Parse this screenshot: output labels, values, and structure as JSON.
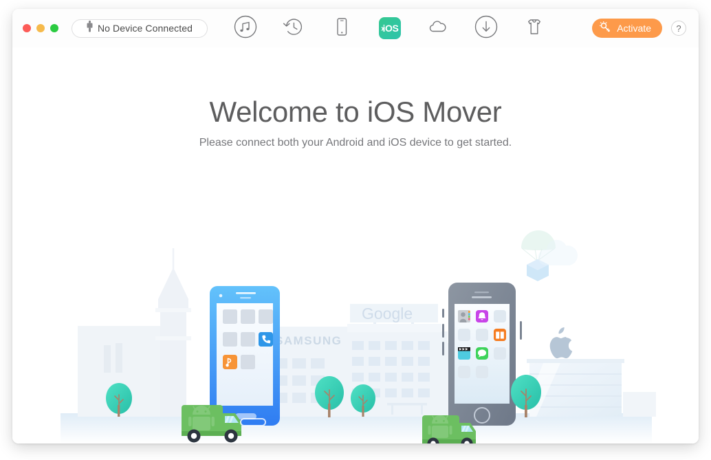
{
  "window": {
    "traffic_lights": [
      "close",
      "minimize",
      "maximize"
    ],
    "colors": {
      "close": "#fc5b57",
      "minimize": "#f6ba4b",
      "maximize": "#2bcb41",
      "accent_orange": "#fd9a4a",
      "ios_green": "#31c6a0",
      "android_blue": "#3f9cf4",
      "truck_green": "#6cbf61",
      "tree_teal": "#3fd0b8"
    }
  },
  "toolbar": {
    "device_status": "No Device Connected",
    "device_icon": "plug-icon",
    "items": [
      {
        "id": "music",
        "icon": "music-note-circle-icon",
        "label": "Music"
      },
      {
        "id": "backup",
        "icon": "history-clock-icon",
        "label": "Backup Restore"
      },
      {
        "id": "device",
        "icon": "phone-outline-icon",
        "label": "Device"
      },
      {
        "id": "iosmover",
        "icon": "ios-mover-badge-icon",
        "label": "iOS Mover",
        "badge_text": "iOS",
        "badge_chevron": "›",
        "active": true
      },
      {
        "id": "cloud",
        "icon": "cloud-icon",
        "label": "Cloud"
      },
      {
        "id": "download",
        "icon": "download-circle-icon",
        "label": "Downloader"
      },
      {
        "id": "ringtone",
        "icon": "ringtone-shirt-icon",
        "label": "Ringtone Maker"
      }
    ],
    "activate_label": "Activate",
    "activate_icon": "key-icon",
    "help_label": "?"
  },
  "main": {
    "headline": "Welcome to iOS Mover",
    "subhead": "Please connect both your Android and iOS device to get started."
  },
  "illustration": {
    "buildings": [
      {
        "id": "samsung",
        "sign": "SAMSUNG"
      },
      {
        "id": "google",
        "sign": "Google"
      },
      {
        "id": "apple",
        "sign": "",
        "logo": "apple-logo-icon"
      },
      {
        "id": "tower",
        "sign": ""
      }
    ],
    "android_phone": {
      "name": "android-phone",
      "apps": [
        "placeholder",
        "placeholder",
        "placeholder",
        "placeholder",
        "placeholder",
        "phone-app-icon",
        "music-app-icon",
        "placeholder",
        ""
      ]
    },
    "ios_phone": {
      "name": "ios-phone",
      "apps": [
        "contacts-app-icon",
        "ringtone-app-icon",
        "placeholder",
        "placeholder",
        "placeholder",
        "books-app-icon",
        "video-app-icon",
        "messages-app-icon",
        "placeholder",
        "placeholder",
        "placeholder",
        ""
      ]
    },
    "trucks": [
      {
        "id": "truck-left",
        "logo": "android-robot-icon"
      },
      {
        "id": "truck-right",
        "logo": "android-robot-icon"
      }
    ],
    "trees": 4,
    "sky_objects": [
      "parachute-box-icon",
      "cloud-shape-icon"
    ]
  }
}
